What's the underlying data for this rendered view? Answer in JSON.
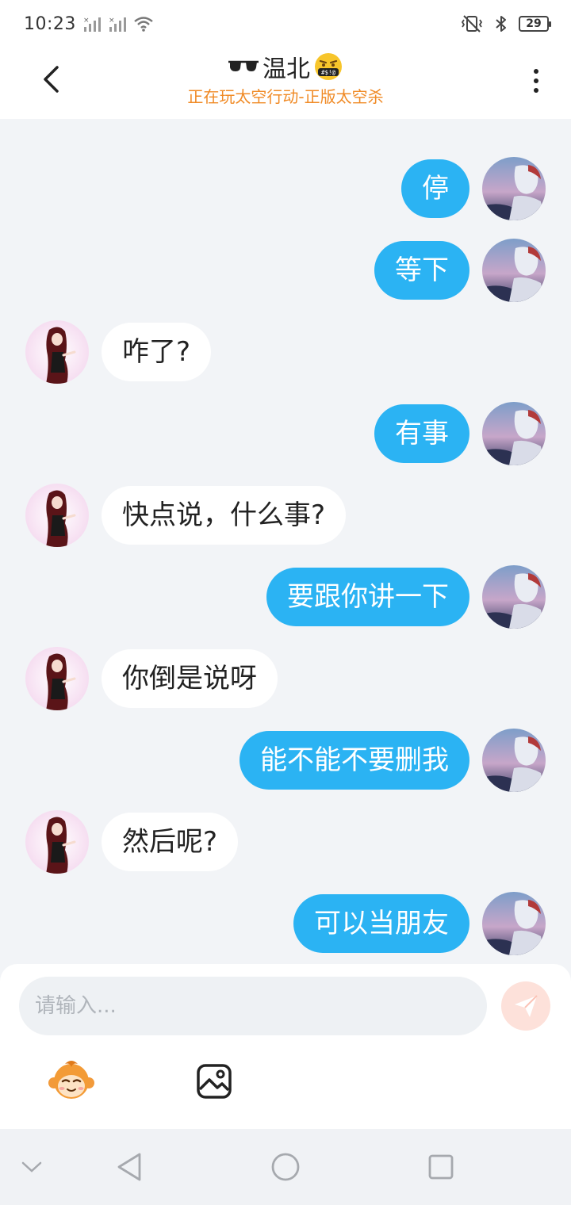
{
  "status_bar": {
    "time": "10:23",
    "battery": "29"
  },
  "header": {
    "title": "温北",
    "subtitle": "正在玩太空行动-正版太空杀",
    "back_icon": "chevron-left-icon",
    "more_icon": "more-vertical-icon"
  },
  "messages": [
    {
      "sender": "me",
      "text": "停"
    },
    {
      "sender": "me",
      "text": "等下"
    },
    {
      "sender": "them",
      "text": "咋了?"
    },
    {
      "sender": "me",
      "text": "有事"
    },
    {
      "sender": "them",
      "text": "快点说，什么事?"
    },
    {
      "sender": "me",
      "text": "要跟你讲一下"
    },
    {
      "sender": "them",
      "text": "你倒是说呀"
    },
    {
      "sender": "me",
      "text": "能不能不要删我"
    },
    {
      "sender": "them",
      "text": "然后呢?"
    },
    {
      "sender": "me",
      "text": "可以当朋友"
    }
  ],
  "composer": {
    "placeholder": "请输入...",
    "value": "",
    "send_icon": "paper-plane-icon",
    "emoji_icon": "monkey-emoji-icon",
    "image_icon": "image-icon"
  },
  "nav": {
    "items": [
      "chevron-down-icon",
      "back-triangle-icon",
      "home-circle-icon",
      "recents-square-icon"
    ]
  },
  "colors": {
    "my_bubble": "#2bb3f3",
    "their_bubble": "#ffffff",
    "subtitle": "#f08a25",
    "chat_background": "#f2f4f7"
  }
}
